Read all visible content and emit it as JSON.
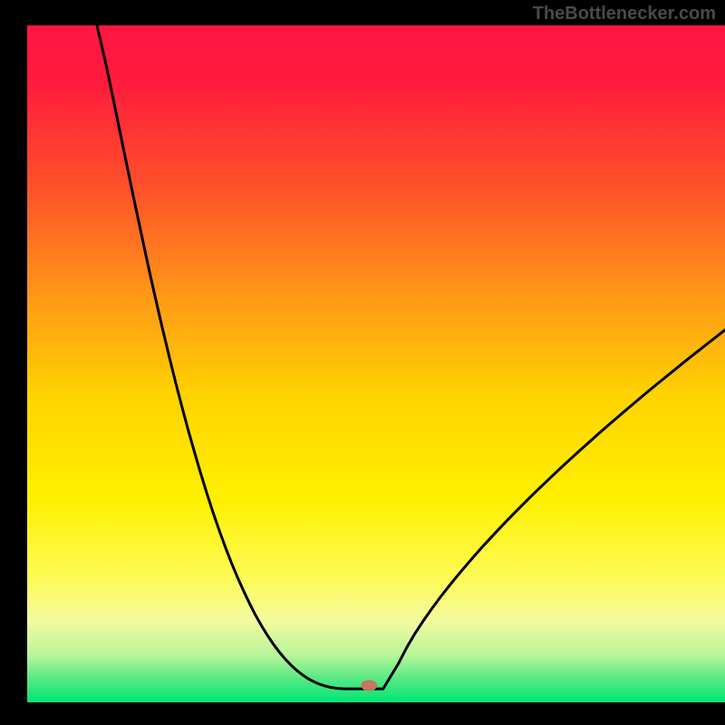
{
  "watermark": "TheBottlenecker.com",
  "chart_data": {
    "type": "line",
    "title": "",
    "xlabel": "",
    "ylabel": "",
    "xlim": [
      0,
      100
    ],
    "ylim": [
      0,
      100
    ],
    "description": "Bottleneck curve: two arms descending to a minimum point (the optimal/no-bottleneck configuration) over a red-to-green vertical gradient background with black border frame.",
    "minimum_point": {
      "x": 49,
      "y": 2
    },
    "left_arm_start": {
      "x": 10,
      "y": 100
    },
    "right_arm_end": {
      "x": 100,
      "y": 55
    },
    "background_gradient": [
      {
        "offset": 0.0,
        "color": "#ff1744"
      },
      {
        "offset": 0.08,
        "color": "#ff1a3e"
      },
      {
        "offset": 0.25,
        "color": "#ff5528"
      },
      {
        "offset": 0.4,
        "color": "#ff9818"
      },
      {
        "offset": 0.55,
        "color": "#ffd400"
      },
      {
        "offset": 0.7,
        "color": "#fff000"
      },
      {
        "offset": 0.82,
        "color": "#fdfb5a"
      },
      {
        "offset": 0.88,
        "color": "#f3faa0"
      },
      {
        "offset": 0.93,
        "color": "#b8f59a"
      },
      {
        "offset": 0.97,
        "color": "#4ae880"
      },
      {
        "offset": 1.0,
        "color": "#00e676"
      }
    ],
    "marker": {
      "x": 49,
      "y": 2.5,
      "color": "#c97560",
      "rx": 9,
      "ry": 6
    }
  },
  "frame": {
    "outer": 800,
    "inner_left": 30,
    "inner_top": 28,
    "inner_width": 770,
    "inner_height": 747
  }
}
